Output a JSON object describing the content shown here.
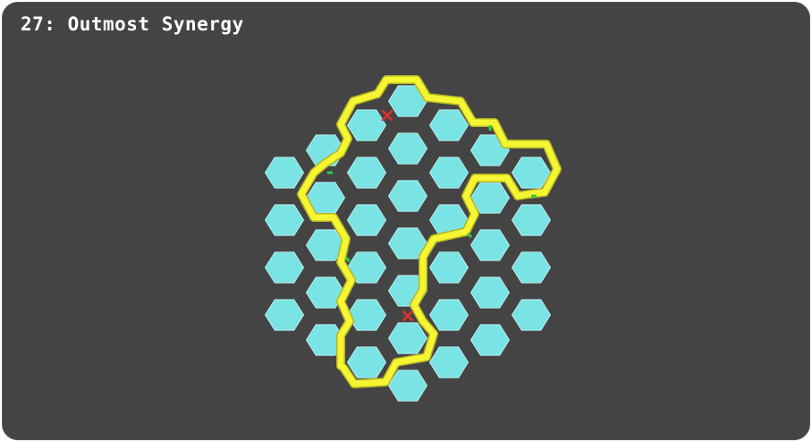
{
  "level": {
    "title": "27: Outmost Synergy"
  },
  "colors": {
    "background": "#444444",
    "cell_fill": "#7ae3e3",
    "cell_stroke": "#b9f0f0",
    "wall": "#f5f534",
    "wall_outline": "#b5b522",
    "gate": "#2fd03a",
    "error_mark": "#e0322a"
  },
  "grid": {
    "columns": [
      {
        "col": 0,
        "rows": [
          0,
          1,
          2,
          3
        ]
      },
      {
        "col": 1,
        "rows": [
          0,
          1,
          2,
          3,
          4
        ]
      },
      {
        "col": 2,
        "rows": [
          0,
          1,
          2,
          3,
          4,
          5
        ]
      },
      {
        "col": 3,
        "rows": [
          0,
          1,
          2,
          3,
          4,
          5,
          6
        ]
      },
      {
        "col": 4,
        "rows": [
          0,
          1,
          2,
          3,
          4,
          5
        ]
      },
      {
        "col": 5,
        "rows": [
          0,
          1,
          2,
          3,
          4
        ]
      },
      {
        "col": 6,
        "rows": [
          0,
          1,
          2,
          3
        ]
      }
    ]
  },
  "icons": {
    "error": "cross-mark-icon",
    "gate": "gate-marker-icon"
  }
}
